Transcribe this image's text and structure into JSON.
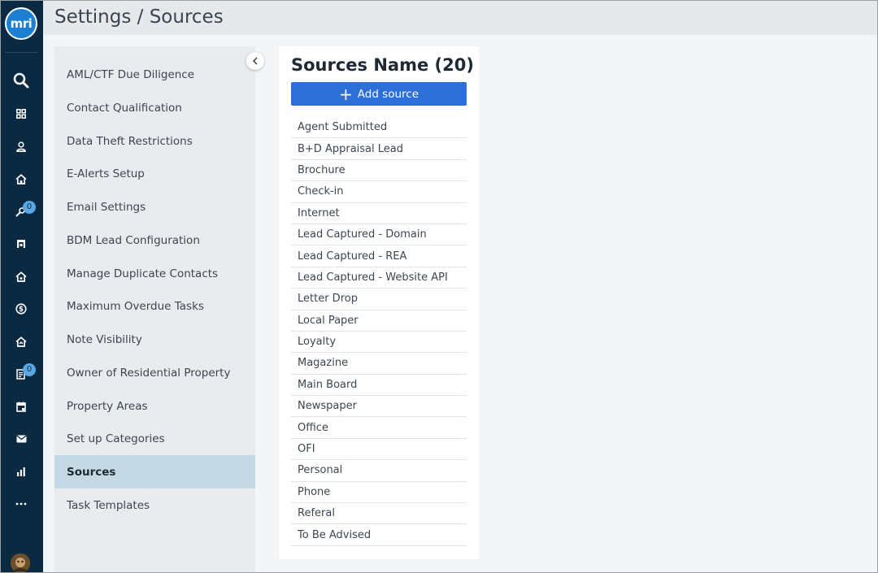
{
  "app": {
    "logo_text": "mri"
  },
  "header": {
    "title": "Settings / Sources"
  },
  "rail": {
    "icons": [
      {
        "name": "search-icon"
      },
      {
        "name": "dashboard-icon"
      },
      {
        "name": "contacts-icon"
      },
      {
        "name": "properties-icon"
      },
      {
        "name": "leads-icon",
        "badge": "0"
      },
      {
        "name": "listings-icon"
      },
      {
        "name": "sales-home-icon"
      },
      {
        "name": "finance-icon"
      },
      {
        "name": "rentals-icon"
      },
      {
        "name": "tasks-icon",
        "badge": "0"
      },
      {
        "name": "calendar-icon"
      },
      {
        "name": "mail-icon"
      },
      {
        "name": "reports-icon"
      },
      {
        "name": "more-icon"
      }
    ]
  },
  "menu": {
    "items": [
      {
        "label": "AML/CTF Due Diligence"
      },
      {
        "label": "Contact Qualification"
      },
      {
        "label": "Data Theft Restrictions"
      },
      {
        "label": "E-Alerts Setup"
      },
      {
        "label": "Email Settings"
      },
      {
        "label": "BDM Lead Configuration"
      },
      {
        "label": "Manage Duplicate Contacts"
      },
      {
        "label": "Maximum Overdue Tasks"
      },
      {
        "label": "Note Visibility"
      },
      {
        "label": "Owner of Residential Property"
      },
      {
        "label": "Property Areas"
      },
      {
        "label": "Set up Categories"
      },
      {
        "label": "Sources",
        "active": true
      },
      {
        "label": "Task Templates"
      }
    ]
  },
  "sources": {
    "title": "Sources Name (20)",
    "add_label": "Add source",
    "items": [
      "Agent Submitted",
      "B+D Appraisal Lead",
      "Brochure",
      "Check-in",
      "Internet",
      "Lead Captured - Domain",
      "Lead Captured - REA",
      "Lead Captured - Website API",
      "Letter Drop",
      "Local Paper",
      "Loyalty",
      "Magazine",
      "Main Board",
      "Newspaper",
      "Office",
      "OFI",
      "Personal",
      "Phone",
      "Referal",
      "To Be Advised"
    ]
  },
  "colors": {
    "rail_bg": "#0b2a41",
    "accent": "#2c6fd6",
    "active_menu_bg": "#c5d9e5",
    "badge_bg": "#5aa9e6"
  }
}
